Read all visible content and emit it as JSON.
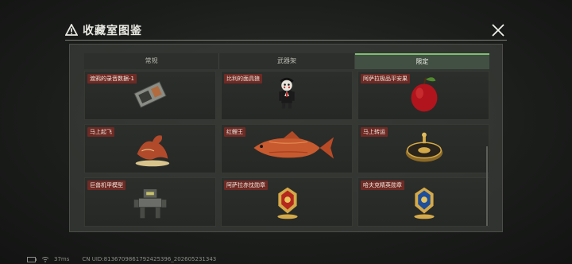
{
  "window": {
    "title": "收藏室图鉴",
    "title_icon": "warning-triangle-icon",
    "close_icon": "close-x-icon"
  },
  "tabs": [
    {
      "label": "常规",
      "active": false
    },
    {
      "label": "武器架",
      "active": false
    },
    {
      "label": "限定",
      "active": true
    }
  ],
  "items": [
    {
      "label": "渡鸦的录音数据-1",
      "icon": "recorder-device-icon"
    },
    {
      "label": "比利的面具狼",
      "icon": "puppet-figure-icon"
    },
    {
      "label": "阿萨拉极品平安果",
      "icon": "red-apple-icon"
    },
    {
      "label": "马上起飞",
      "icon": "horse-statue-icon"
    },
    {
      "label": "红鲤王",
      "icon": "red-carp-icon"
    },
    {
      "label": "马上转运",
      "icon": "golden-compass-icon"
    },
    {
      "label": "巨兽机甲模型",
      "icon": "mech-model-icon"
    },
    {
      "label": "阿萨拉赤忱勋章",
      "icon": "red-medal-icon"
    },
    {
      "label": "哈夫克精英勋章",
      "icon": "blue-medal-icon"
    }
  ],
  "status": {
    "ping": "37ms",
    "uid": "CN UID:8136709861792425396_202605231343"
  },
  "colors": {
    "accent": "#7fbf70",
    "label_bg": "#6e2a24"
  }
}
